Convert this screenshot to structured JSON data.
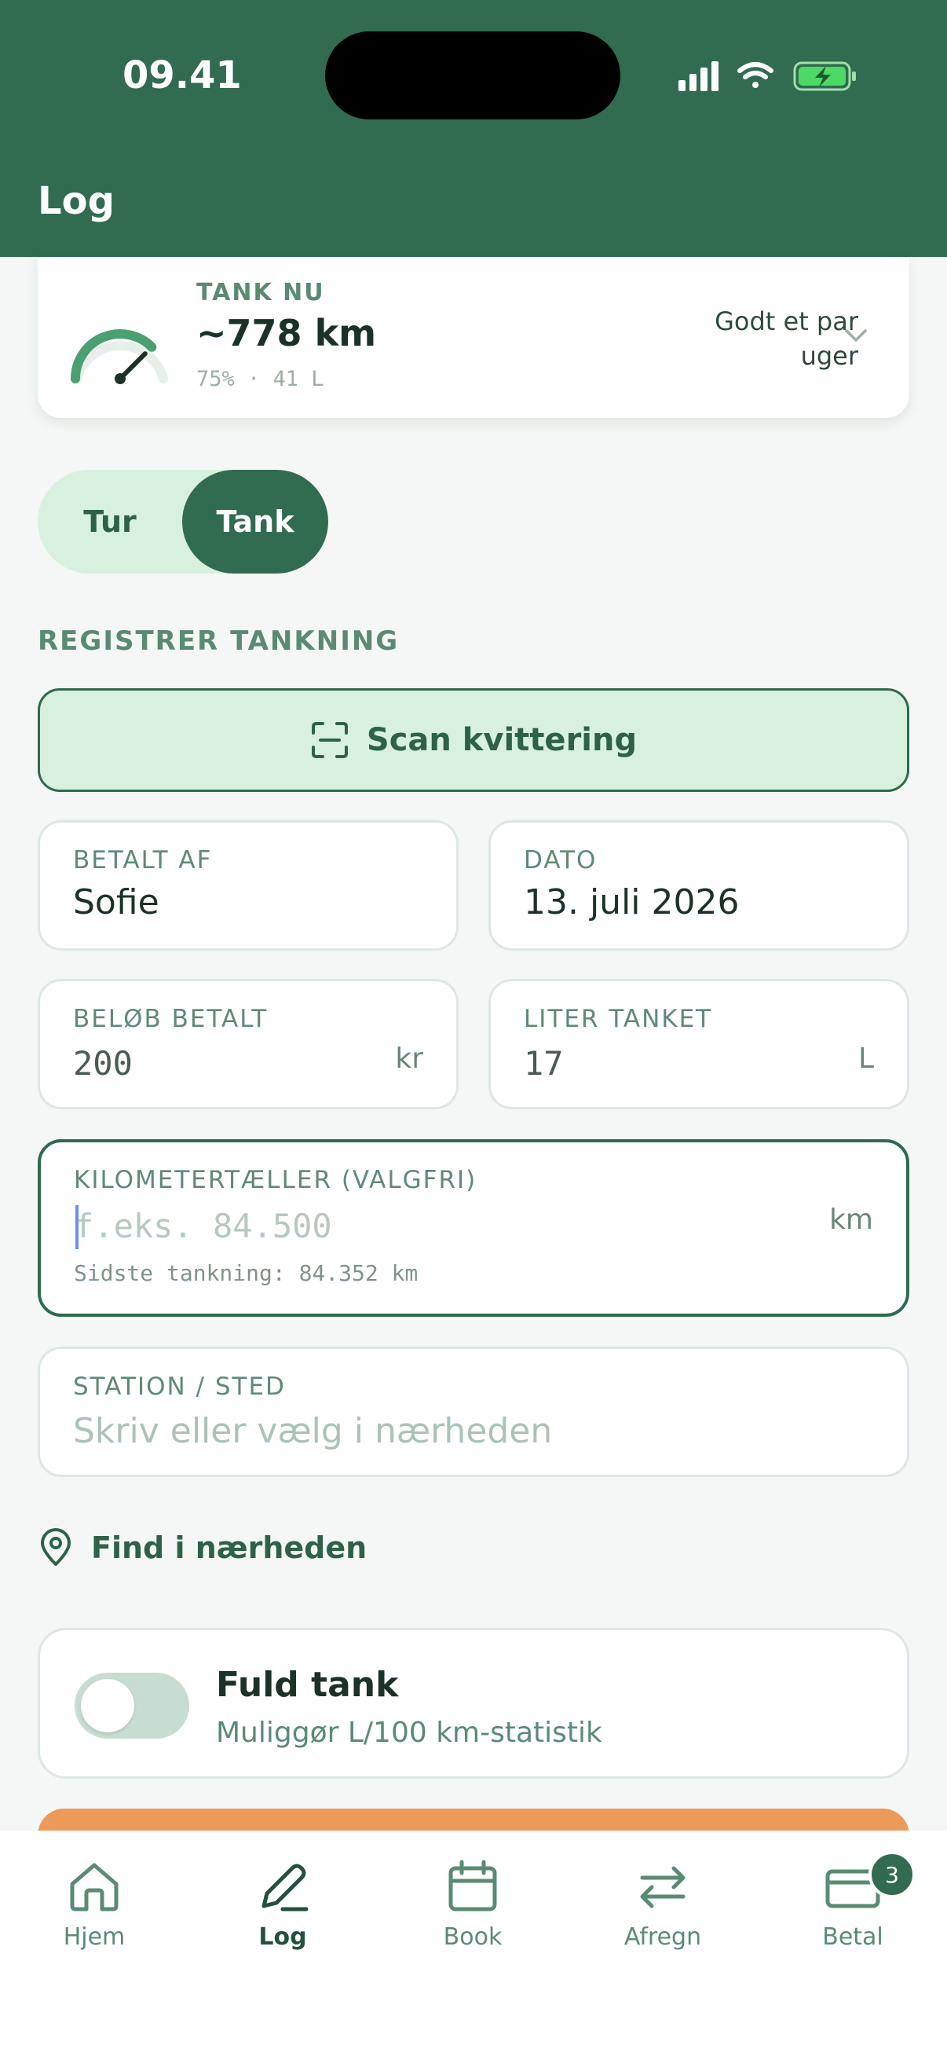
{
  "status_bar": {
    "time": "09.41"
  },
  "header": {
    "title": "Log"
  },
  "tank_card": {
    "label": "TANK NU",
    "range": "~778 km",
    "detail": "75% · 41 L",
    "duration": "Godt et par uger",
    "fill_fraction": 0.75
  },
  "segment": {
    "options": [
      "Tur",
      "Tank"
    ],
    "selected": "Tank"
  },
  "section_title": "REGISTRER TANKNING",
  "scan_button": {
    "label": "Scan kvittering"
  },
  "fields": {
    "paid_by": {
      "label": "BETALT AF",
      "value": "Sofie"
    },
    "date": {
      "label": "DATO",
      "value": "13. juli 2026"
    },
    "amount": {
      "label": "BELØB BETALT",
      "value": "200",
      "unit": "kr"
    },
    "liters": {
      "label": "LITER TANKET",
      "value": "17",
      "unit": "L"
    },
    "odometer": {
      "label": "KILOMETERTÆLLER (VALGFRI)",
      "placeholder": "f.eks. 84.500",
      "unit": "km",
      "hint": "Sidste tankning: 84.352 km"
    },
    "station": {
      "label": "STATION / STED",
      "placeholder": "Skriv eller vælg i nærheden"
    }
  },
  "find_nearby": {
    "label": "Find i nærheden"
  },
  "full_tank": {
    "title": "Fuld tank",
    "subtitle": "Muliggør L/100 km-statistik",
    "enabled": false
  },
  "nav": {
    "items": [
      {
        "label": "Hjem",
        "icon": "home-icon"
      },
      {
        "label": "Log",
        "icon": "pencil-icon"
      },
      {
        "label": "Book",
        "icon": "calendar-icon"
      },
      {
        "label": "Afregn",
        "icon": "swap-arrows-icon"
      },
      {
        "label": "Betal",
        "icon": "card-icon",
        "badge": "3"
      }
    ],
    "active": "Log"
  },
  "colors": {
    "brand": "#316b50",
    "accent_light": "#d8f1de",
    "orange": "#ec9a59"
  }
}
